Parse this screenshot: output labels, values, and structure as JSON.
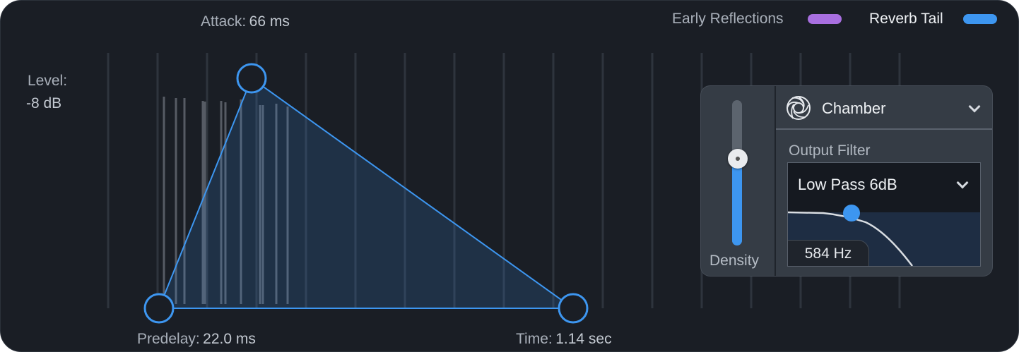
{
  "legend": {
    "early_reflections": {
      "label": "Early Reflections",
      "color": "#a86fe0"
    },
    "reverb_tail": {
      "label": "Reverb Tail",
      "color": "#3d96f0"
    }
  },
  "envelope": {
    "attack_label": "Attack:",
    "attack_value": "66 ms",
    "level_label": "Level:",
    "level_value": "-8 dB",
    "predelay_label": "Predelay:",
    "predelay_value": "22.0 ms",
    "time_label": "Time:",
    "time_value": "1.14 sec"
  },
  "density": {
    "label": "Density",
    "level": 0.63
  },
  "room": {
    "icon": "aperture-icon",
    "selected": "Chamber"
  },
  "output_filter": {
    "label": "Output Filter",
    "selected": "Low Pass 6dB",
    "frequency": "584 Hz"
  },
  "colors": {
    "accent": "#3d96f0",
    "panel": "#1a1e25"
  }
}
